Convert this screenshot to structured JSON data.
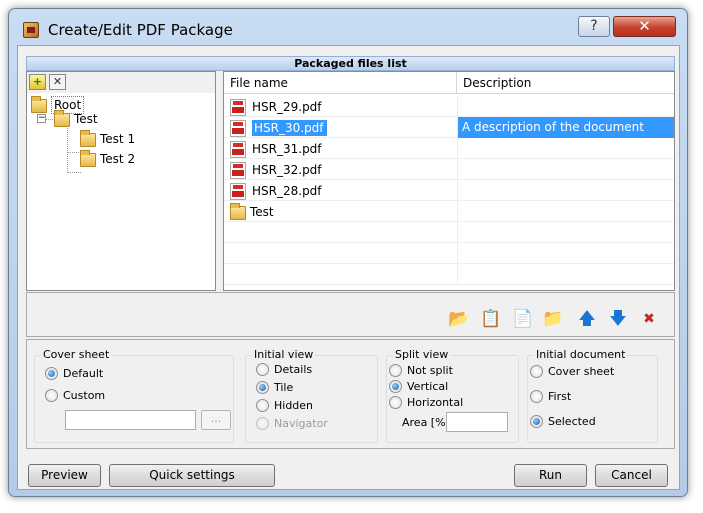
{
  "window": {
    "title": "Create/Edit PDF Package",
    "help_glyph": "?",
    "close_glyph": "✕"
  },
  "packaged_files_header": "Packaged files list",
  "tree": {
    "toolbar": {
      "add_icon": "add-folder-icon",
      "remove_icon": "remove-folder-icon"
    },
    "nodes": [
      {
        "label": "Root",
        "level": 0
      },
      {
        "label": "Test",
        "level": 1,
        "expanded": true
      },
      {
        "label": "Test 1",
        "level": 2
      },
      {
        "label": "Test 2",
        "level": 2
      }
    ],
    "expander_glyph": "−"
  },
  "file_list": {
    "columns": [
      "File name",
      "Description"
    ],
    "rows": [
      {
        "name": "HSR_29.pdf",
        "description": "",
        "icon": "pdf-file-icon"
      },
      {
        "name": "HSR_30.pdf",
        "description": "A description of the document",
        "icon": "pdf-file-icon",
        "selected": true
      },
      {
        "name": "HSR_31.pdf",
        "description": "",
        "icon": "pdf-file-icon"
      },
      {
        "name": "HSR_32.pdf",
        "description": "",
        "icon": "pdf-file-icon"
      },
      {
        "name": "HSR_28.pdf",
        "description": "",
        "icon": "pdf-file-icon"
      },
      {
        "name": "Test",
        "description": "",
        "icon": "folder-icon"
      }
    ]
  },
  "list_toolbar": [
    {
      "icon": "open-folder-icon",
      "glyph": "📂"
    },
    {
      "icon": "clipboard-paste-icon",
      "glyph": "📋"
    },
    {
      "icon": "add-file-icon",
      "glyph": "📄"
    },
    {
      "icon": "add-folder-icon",
      "glyph": "📁"
    },
    {
      "icon": "move-up-icon",
      "glyph": "🡅"
    },
    {
      "icon": "move-down-icon",
      "glyph": "🡇"
    },
    {
      "icon": "delete-icon",
      "glyph": "✖"
    }
  ],
  "cover_sheet": {
    "title": "Cover sheet",
    "options": [
      "Default",
      "Custom"
    ],
    "selected": "Default",
    "custom_path": "",
    "browse_label": "..."
  },
  "initial_view": {
    "title": "Initial view",
    "options": [
      "Details",
      "Tile",
      "Hidden",
      "Navigator"
    ],
    "selected": "Tile",
    "disabled": [
      "Navigator"
    ]
  },
  "split_view": {
    "title": "Split view",
    "options": [
      "Not split",
      "Vertical",
      "Horizontal"
    ],
    "selected": "Vertical",
    "area_label": "Area [%]",
    "area_value": ""
  },
  "initial_document": {
    "title": "Initial document",
    "options": [
      "Cover sheet",
      "First",
      "Selected"
    ],
    "selected": "Selected"
  },
  "buttons": {
    "preview": "Preview",
    "quick_settings": "Quick settings",
    "run": "Run",
    "cancel": "Cancel"
  },
  "colors": {
    "selection": "#3399ff",
    "title_bar": "#c8dcf2",
    "close_button": "#c8412c"
  }
}
